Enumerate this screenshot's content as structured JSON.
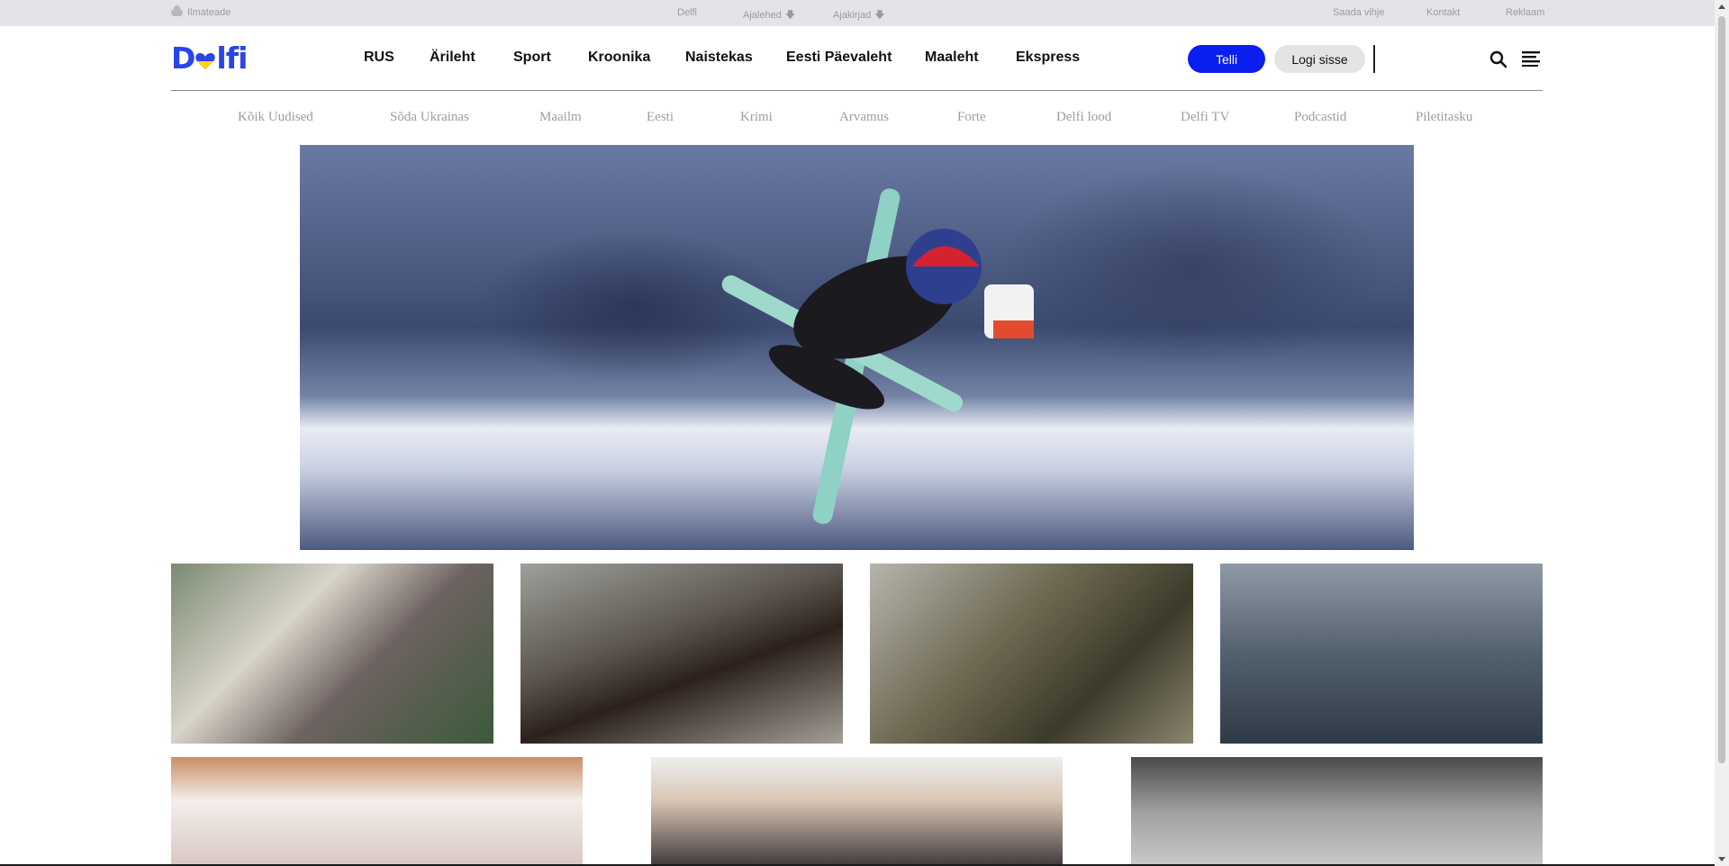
{
  "topbar": {
    "weather_label": "Ilmateade",
    "delfi_label": "Delfi",
    "ajalehed_label": "Ajalehed",
    "ajakirjad_label": "Ajakirjad",
    "saada_vihje_label": "Saada vihje",
    "kontakt_label": "Kontakt",
    "reklaam_label": "Reklaam"
  },
  "header": {
    "logo_text_1": "D",
    "logo_text_2": "lfi",
    "nav": [
      "RUS",
      "Ärileht",
      "Sport",
      "Kroonika",
      "Naistekas",
      "Eesti Päevaleht",
      "Maaleht",
      "Ekspress"
    ],
    "telli_label": "Telli",
    "logi_label": "Logi sisse"
  },
  "subnav": [
    "Kõik Uudised",
    "Sõda Ukrainas",
    "Maailm",
    "Eesti",
    "Krimi",
    "Arvamus",
    "Forte",
    "Delfi lood",
    "Delfi TV",
    "Podcastid",
    "Piletitasku"
  ],
  "colors": {
    "brand_blue": "#2a45e6",
    "telli_blue": "#0b1ef0",
    "heart_blue": "#2a45e6",
    "heart_yellow": "#ffd500"
  }
}
